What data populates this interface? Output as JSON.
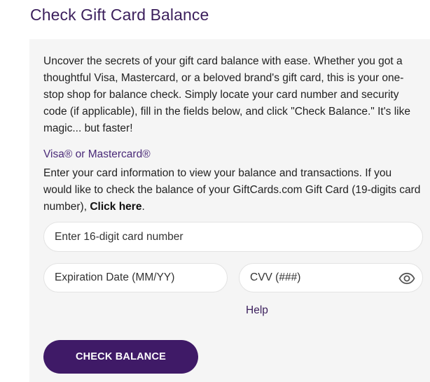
{
  "page": {
    "title": "Check Gift Card Balance"
  },
  "intro": {
    "text": "Uncover the secrets of your gift card balance with ease. Whether you got a thoughtful Visa, Mastercard, or a beloved brand's gift card, this is your one-stop shop for balance check. Simply locate your card number and security code (if applicable), fill in the fields below, and click \"Check Balance.\" It's like magic... but faster!"
  },
  "visa_section": {
    "title": "Visa® or Mastercard®",
    "desc_before_link": "Enter your card information to view your balance and transactions. If you would like to check the balance of your GiftCards.com Gift Card (19-digits card number), ",
    "link_label": "Click here",
    "desc_after_link": "."
  },
  "form": {
    "card_number": {
      "value": "",
      "placeholder": "Enter 16-digit card number"
    },
    "expiration": {
      "value": "",
      "placeholder": "Expiration Date (MM/YY)"
    },
    "cvv": {
      "value": "",
      "placeholder": "CVV (###)"
    },
    "toggle_icon": "eye-icon",
    "help_label": "Help",
    "submit_label": "CHECK BALANCE"
  },
  "colors": {
    "brand_purple": "#3f1a67",
    "title_purple": "#3b1f5c",
    "panel_bg": "#f5f5f5"
  }
}
